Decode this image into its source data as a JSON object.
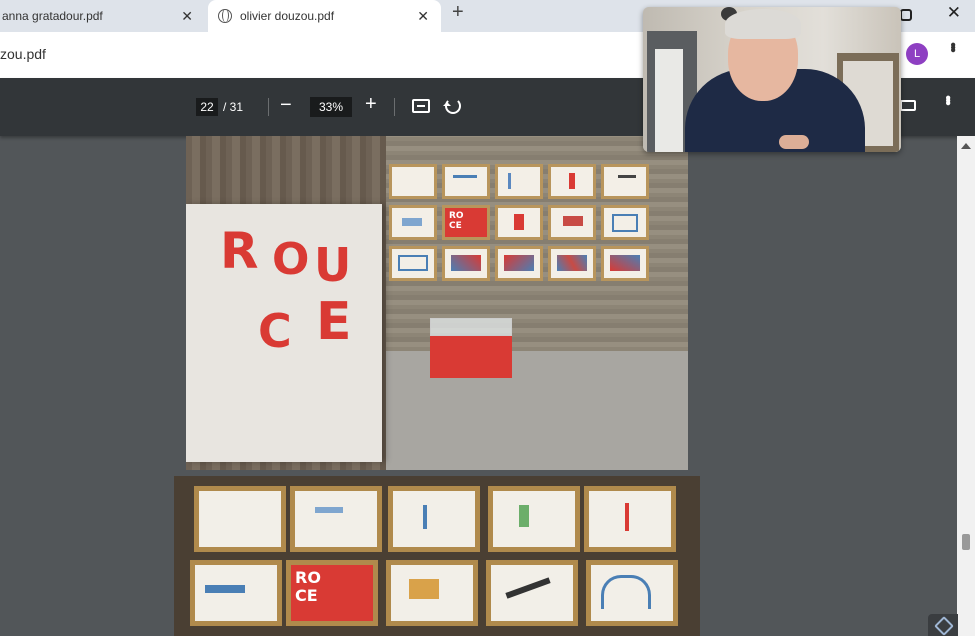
{
  "tabs": [
    {
      "label": "anna gratadour.pdf"
    },
    {
      "label": "olivier douzou.pdf"
    }
  ],
  "address": {
    "url": "zou.pdf"
  },
  "profile": {
    "initial": "L",
    "color": "#8e3fc2"
  },
  "pdf_toolbar": {
    "page_current": "22",
    "page_total": "/ 31",
    "zoom": "33%"
  },
  "document": {
    "board_letters": [
      "R",
      "O",
      "U",
      "C",
      "E"
    ],
    "red_frame_letters": "RO\nCE",
    "accent_red": "#d93a34"
  }
}
